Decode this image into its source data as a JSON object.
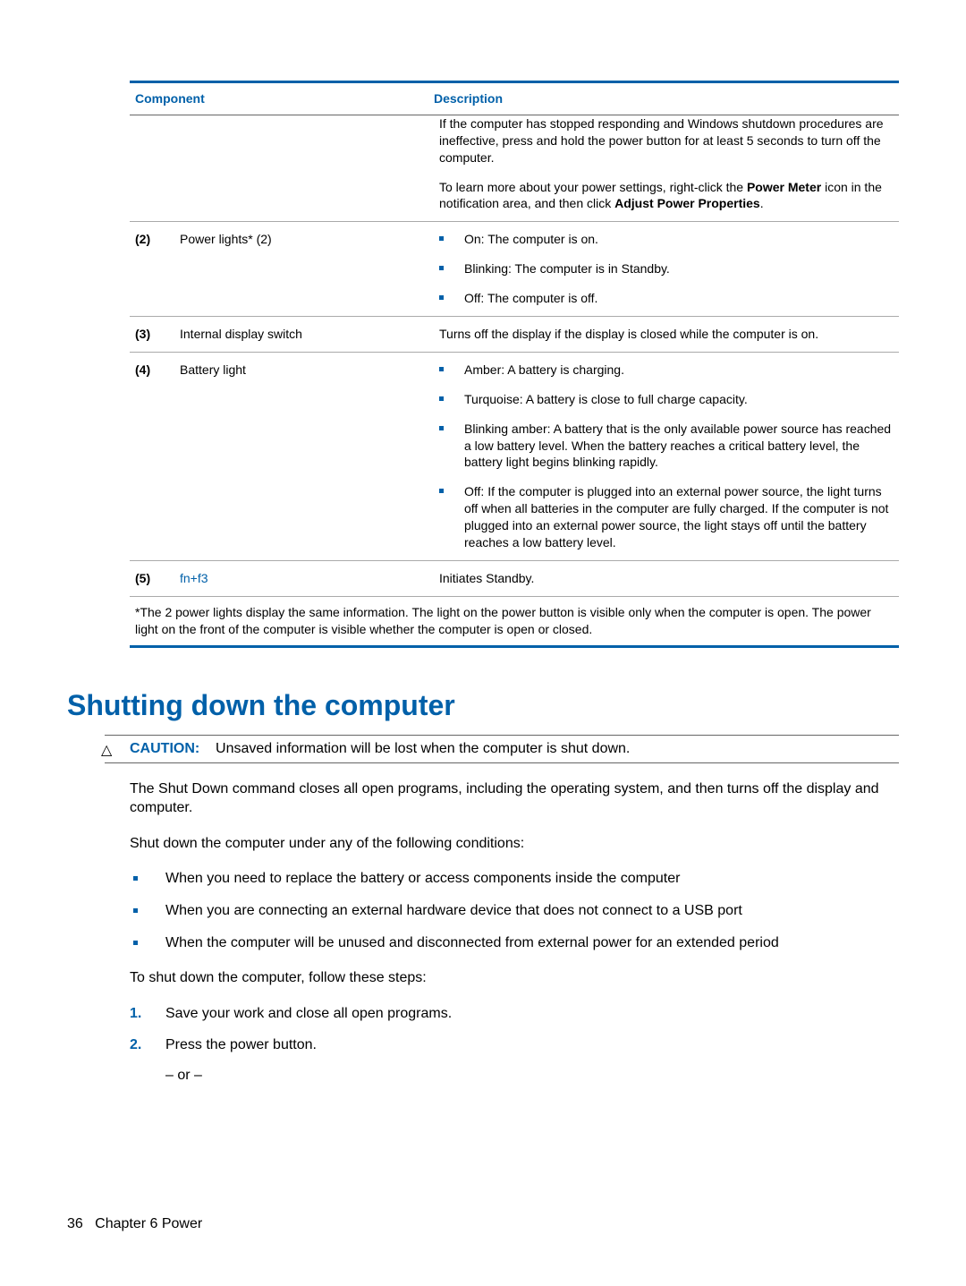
{
  "table": {
    "header": {
      "component": "Component",
      "description": "Description"
    },
    "row1": {
      "p1": "If the computer has stopped responding and Windows shutdown procedures are ineffective, press and hold the power button for at least 5 seconds to turn off the computer.",
      "p2_pre": "To learn more about your power settings, right-click the ",
      "p2_b1": "Power Meter",
      "p2_mid": " icon in the notification area, and then click ",
      "p2_b2": "Adjust Power Properties",
      "p2_post": "."
    },
    "row2": {
      "idx": "(2)",
      "comp": "Power lights* (2)",
      "b1": "On: The computer is on.",
      "b2": "Blinking: The computer is in Standby.",
      "b3": "Off: The computer is off."
    },
    "row3": {
      "idx": "(3)",
      "comp": "Internal display switch",
      "desc": "Turns off the display if the display is closed while the computer is on."
    },
    "row4": {
      "idx": "(4)",
      "comp": "Battery light",
      "b1": "Amber: A battery is charging.",
      "b2": "Turquoise: A battery is close to full charge capacity.",
      "b3": "Blinking amber: A battery that is the only available power source has reached a low battery level. When the battery reaches a critical battery level, the battery light begins blinking rapidly.",
      "b4": "Off: If the computer is plugged into an external power source, the light turns off when all batteries in the computer are fully charged. If the computer is not plugged into an external power source, the light stays off until the battery reaches a low battery level."
    },
    "row5": {
      "idx": "(5)",
      "comp": "fn+f3",
      "desc": "Initiates Standby."
    },
    "footnote": "*The 2 power lights display the same information. The light on the power button is visible only when the computer is open. The power light on the front of the computer is visible whether the computer is open or closed."
  },
  "section": {
    "heading": "Shutting down the computer",
    "caution_icon": "△",
    "caution_label": "CAUTION:",
    "caution_text": "Unsaved information will be lost when the computer is shut down.",
    "p1": "The Shut Down command closes all open programs, including the operating system, and then turns off the display and computer.",
    "p2": "Shut down the computer under any of the following conditions:",
    "bullets": {
      "b1": "When you need to replace the battery or access components inside the computer",
      "b2": "When you are connecting an external hardware device that does not connect to a USB port",
      "b3": "When the computer will be unused and disconnected from external power for an extended period"
    },
    "p3": "To shut down the computer, follow these steps:",
    "steps": {
      "n1": "1.",
      "s1": "Save your work and close all open programs.",
      "n2": "2.",
      "s2": "Press the power button.",
      "or": "– or –"
    }
  },
  "footer": {
    "page": "36",
    "chapter": "Chapter 6   Power"
  }
}
